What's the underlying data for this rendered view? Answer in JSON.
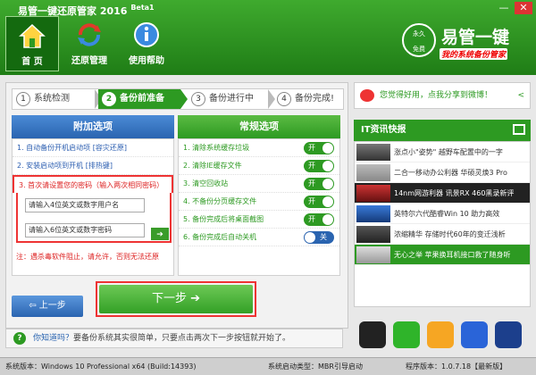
{
  "window": {
    "title": "易管一键还原管家",
    "version": "2016",
    "beta": "Beta1",
    "min": "—",
    "close": "✕"
  },
  "nav": [
    {
      "label": "首 页"
    },
    {
      "label": "还原管理"
    },
    {
      "label": "使用帮助"
    }
  ],
  "logo": {
    "badge_top": "永久",
    "badge_bottom": "免费",
    "title": "易管一键",
    "subtitle": "我的系统备份管家"
  },
  "steps": [
    {
      "num": "1",
      "label": "系统检测"
    },
    {
      "num": "2",
      "label": "备份前准备"
    },
    {
      "num": "3",
      "label": "备份进行中"
    },
    {
      "num": "4",
      "label": "备份完成!"
    }
  ],
  "extra_options": {
    "title": "附加选项",
    "items": [
      "1. 自动备份开机启动项 [容灾还原]",
      "2. 安装启动项到开机 [排热键]",
      "3. 首次请设置您的密码（输入两次相同密码）"
    ],
    "user_placeholder": "请输入4位英文或数字用户名",
    "pwd_placeholder": "请输入6位英文或数字密码",
    "go_icon": "➔",
    "warning": "注：遇杀毒软件阻止，请允许，否则无法还原"
  },
  "normal_options": {
    "title": "常规选项",
    "items": [
      {
        "label": "1. 清除系统缓存垃圾",
        "toggle": "开"
      },
      {
        "label": "2. 清除IE缓存文件",
        "toggle": "开"
      },
      {
        "label": "3. 清空回收站",
        "toggle": "开"
      },
      {
        "label": "4. 不备份分页缓存文件",
        "toggle": "开"
      },
      {
        "label": "5. 备份完成后将桌面截图",
        "toggle": "开"
      },
      {
        "label": "6. 备份完成后自动关机",
        "toggle": "关"
      }
    ]
  },
  "buttons": {
    "prev": "上一步",
    "next": "下一步",
    "prev_icon": "⇦",
    "next_icon": "➔"
  },
  "tip": {
    "icon": "?",
    "text_a": "你知道吗？",
    "text_b": "要备份系统其实很简单，只要点击两次下一步按钮就开始了。"
  },
  "share": {
    "text": "您觉得好用，点我分享到微博！",
    "icon": "<"
  },
  "news": {
    "title": "IT资讯快报",
    "items": [
      "涨点小\"姿势\" 越野车配置中的一字",
      "二合一移动办公利器 华硕灵焕3 Pro",
      "14nm网游利器 讯景RX 460黑录新评",
      "英特尔六代酷睿Win 10 助力高效",
      "浓缩精华 存储时代60年的变迁浅析",
      "无心之举 苹果换耳机接口救了随身听"
    ]
  },
  "status": {
    "os": "系统版本：Windows 10 Professional x64 (Build:14393)",
    "boot": "系统启动类型：MBR引导启动",
    "ver": "程序版本：1.0.7.18【最新版】"
  },
  "colors": {
    "green": "#2d9a22",
    "blue": "#2a64b0",
    "red": "#dd2222"
  }
}
